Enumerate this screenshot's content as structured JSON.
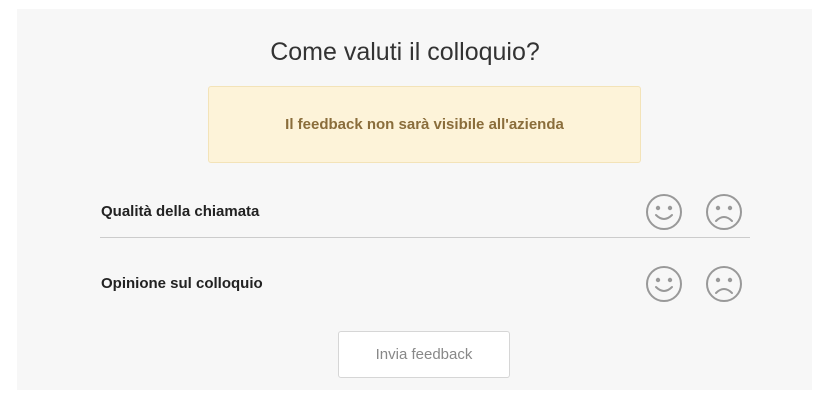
{
  "dialog": {
    "title": "Come valuti il colloquio?",
    "notice": "Il feedback non sarà visibile all'azienda",
    "rows": [
      {
        "label": "Qualità della chiamata"
      },
      {
        "label": "Opinione sul colloquio"
      }
    ],
    "submit_label": "Invia feedback"
  },
  "icons": {
    "positive": "smiley-face-icon",
    "negative": "sad-face-icon"
  },
  "colors": {
    "card_background": "#f7f7f7",
    "notice_background": "#fdf3d9",
    "notice_text": "#8a6d3b",
    "icon_stroke": "#999999"
  }
}
